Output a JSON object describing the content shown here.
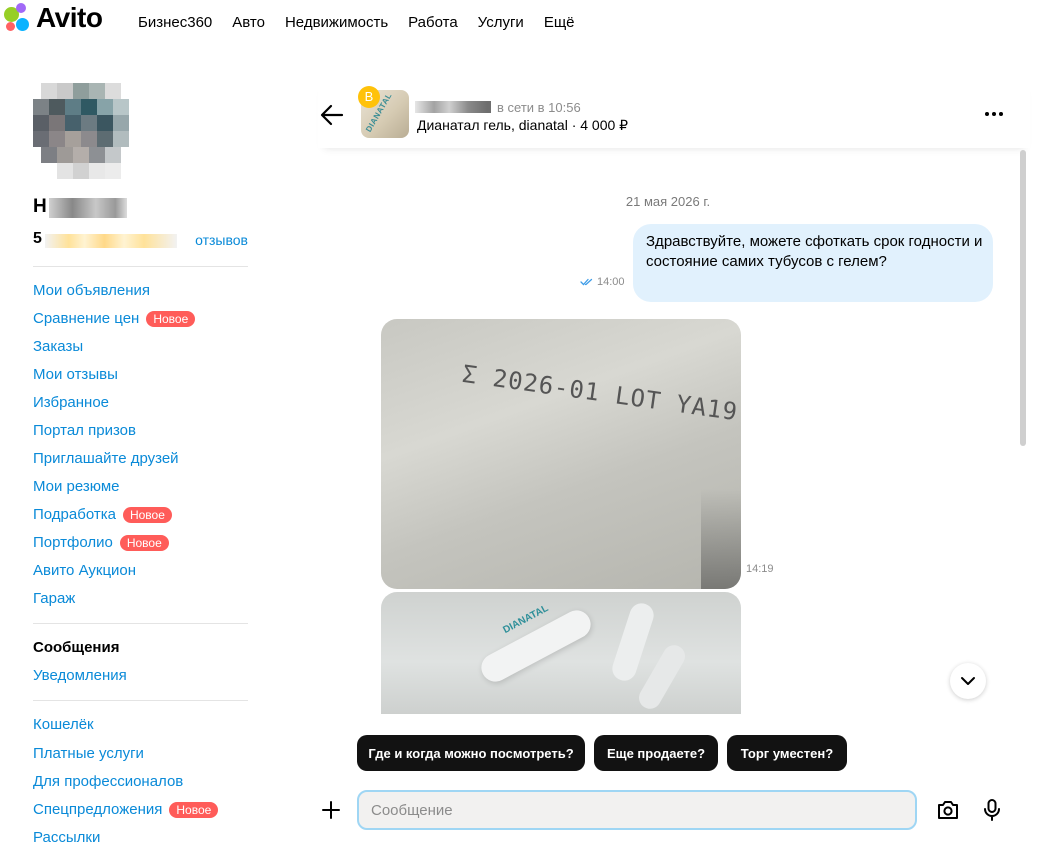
{
  "brand": {
    "logo_text": "Avito",
    "dot_colors": [
      "#97cf26",
      "#a169f7",
      "#ff6163",
      "#0ab3ff"
    ]
  },
  "topnav": {
    "items": [
      "Бизнес360",
      "Авто",
      "Недвижимость",
      "Работа",
      "Услуги",
      "Ещё"
    ]
  },
  "profile": {
    "name_initial": "Н",
    "rating_initial": "5",
    "reviews_suffix": "отзывов"
  },
  "sidebar": {
    "group1": [
      {
        "label": "Мои объявления",
        "badge": ""
      },
      {
        "label": "Сравнение цен",
        "badge": "Новое"
      },
      {
        "label": "Заказы",
        "badge": ""
      },
      {
        "label": "Мои отзывы",
        "badge": ""
      },
      {
        "label": "Избранное",
        "badge": ""
      },
      {
        "label": "Портал призов",
        "badge": ""
      },
      {
        "label": "Приглашайте друзей",
        "badge": ""
      },
      {
        "label": "Мои резюме",
        "badge": ""
      },
      {
        "label": "Подработка",
        "badge": "Новое"
      },
      {
        "label": "Портфолио",
        "badge": "Новое"
      },
      {
        "label": "Авито Аукцион",
        "badge": ""
      },
      {
        "label": "Гараж",
        "badge": ""
      }
    ],
    "group2": [
      {
        "label": "Сообщения",
        "active": true
      },
      {
        "label": "Уведомления",
        "active": false
      }
    ],
    "group3": [
      {
        "label": "Кошелёк",
        "badge": ""
      },
      {
        "label": "Платные услуги",
        "badge": ""
      },
      {
        "label": "Для профессионалов",
        "badge": ""
      },
      {
        "label": "Спецпредложения",
        "badge": "Новое"
      },
      {
        "label": "Рассылки",
        "badge": ""
      }
    ]
  },
  "chat": {
    "seller_badge": "В",
    "thumb_text": "DIANATAL",
    "online_status": "в сети в 10:56",
    "listing": "Дианатал гель, dianatal · 4 000 ₽",
    "date_separator": "21 мая 2026 г.",
    "outgoing_message": "Здравствуйте, можете сфоткать срок годности и состояние самих тубусов с гелем?",
    "outgoing_time": "14:00",
    "image_time": "14:19",
    "image1_stamp": "Σ 2026-01 LOT YA19",
    "image2_label": "DIANATAL"
  },
  "quick_replies": [
    "Где и когда можно посмотреть?",
    "Еще продаете?",
    "Торг уместен?"
  ],
  "composer": {
    "placeholder": "Сообщение"
  },
  "colors": {
    "link": "#0a8ad8",
    "badge_new": "#ff5c59",
    "outgoing_bubble": "#e1f1fd",
    "quick_reply_bg": "#121212",
    "input_border": "#9fd6f4",
    "seller_badge": "#ffc20a"
  }
}
